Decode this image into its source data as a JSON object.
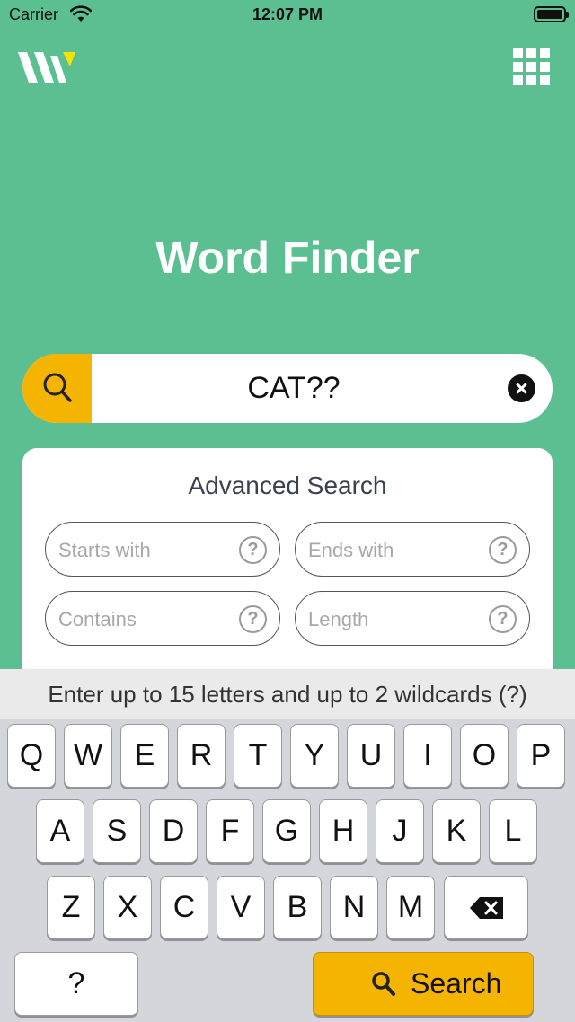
{
  "status_bar": {
    "carrier": "Carrier",
    "time": "12:07 PM",
    "icons": [
      "wifi-icon",
      "battery-icon"
    ]
  },
  "header": {
    "logo": "w-logo",
    "menu_icon": "grid-menu-icon"
  },
  "page_title": "Word Finder",
  "search": {
    "value": "CAT??",
    "icon": "search-icon",
    "clear_icon": "clear-icon"
  },
  "advanced": {
    "title": "Advanced Search",
    "fields": [
      {
        "placeholder": "Starts with",
        "help": "?"
      },
      {
        "placeholder": "Ends with",
        "help": "?"
      },
      {
        "placeholder": "Contains",
        "help": "?"
      },
      {
        "placeholder": "Length",
        "help": "?"
      }
    ]
  },
  "keyboard": {
    "hint": "Enter up to 15 letters and up to 2 wildcards (?)",
    "row1": [
      "Q",
      "W",
      "E",
      "R",
      "T",
      "Y",
      "U",
      "I",
      "O",
      "P"
    ],
    "row2": [
      "A",
      "S",
      "D",
      "F",
      "G",
      "H",
      "J",
      "K",
      "L"
    ],
    "row3": [
      "Z",
      "X",
      "C",
      "V",
      "B",
      "N",
      "M"
    ],
    "wildcard": "?",
    "search_label": "Search"
  },
  "colors": {
    "background": "#5bbf92",
    "accent": "#f5b400",
    "keyboard_bg": "#d4d6db"
  }
}
